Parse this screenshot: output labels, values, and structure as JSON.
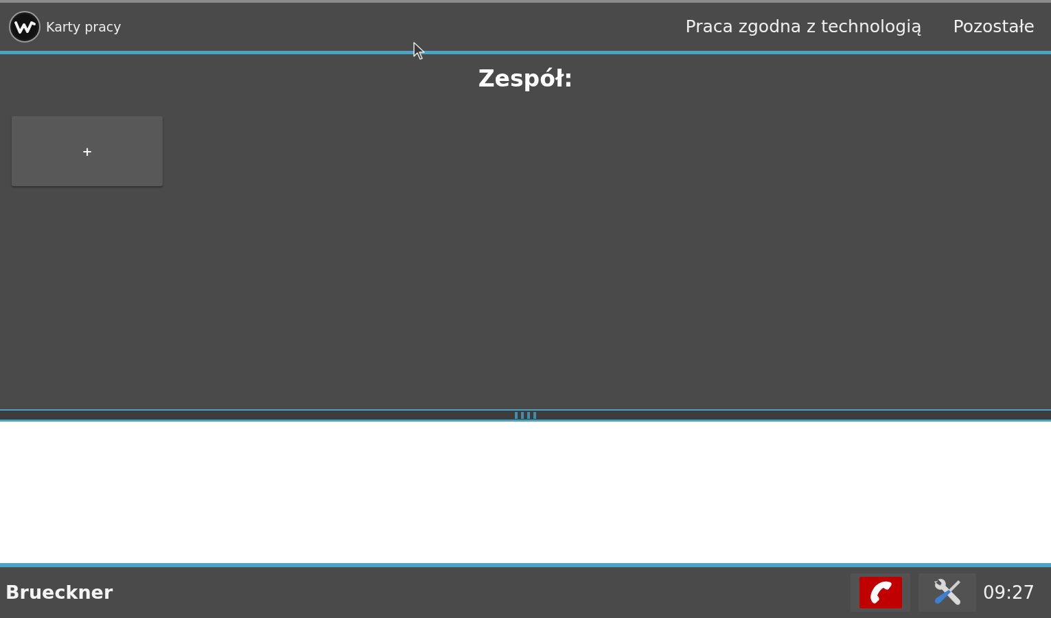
{
  "header": {
    "app_title": "Karty pracy",
    "nav": [
      {
        "label": "Praca zgodna z technologią"
      },
      {
        "label": "Pozostałe"
      }
    ]
  },
  "team": {
    "title": "Zespół:",
    "add_tile": {
      "label": "+"
    }
  },
  "footer": {
    "user": "Brueckner",
    "time": "09:27"
  }
}
